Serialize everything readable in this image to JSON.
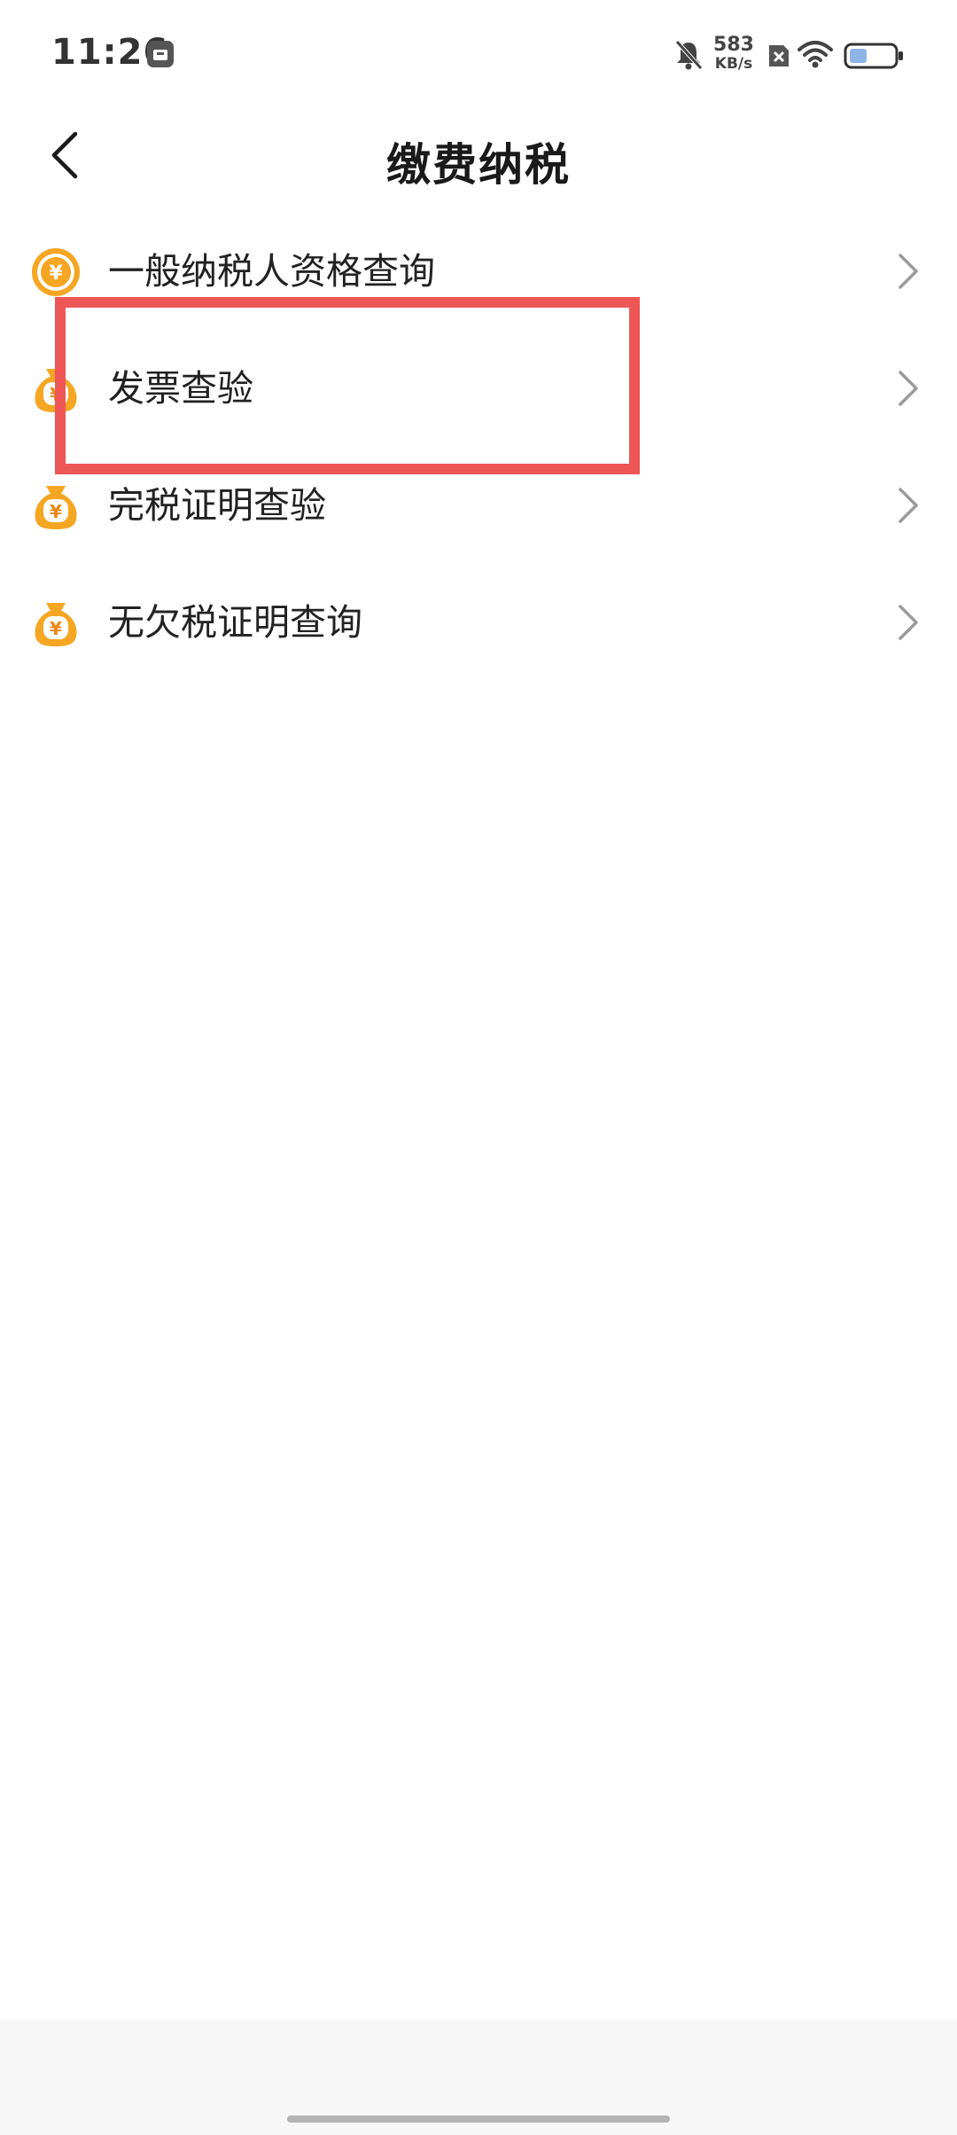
{
  "status_bar": {
    "time": "11:26",
    "net_speed_value": "583",
    "net_speed_unit": "KB/s",
    "battery_level": 0.4,
    "icons": [
      "notification-icon",
      "bell-muted-icon",
      "sim-off-icon",
      "wifi-icon",
      "battery-icon"
    ]
  },
  "header": {
    "title": "缴费纳税",
    "back_icon": "back-arrow-icon"
  },
  "menu": {
    "items": [
      {
        "label": "一般纳税人资格查询",
        "icon": "yuan-coin-icon"
      },
      {
        "label": "发票查验",
        "icon": "money-bag-icon"
      },
      {
        "label": "完税证明查验",
        "icon": "money-bag-icon"
      },
      {
        "label": "无欠税证明查询",
        "icon": "money-bag-icon"
      }
    ]
  },
  "colors": {
    "icon_orange": "#f5a623",
    "icon_orange_dark": "#e8891a",
    "highlight": "#ee5555",
    "chevron": "#9a9a9a"
  }
}
